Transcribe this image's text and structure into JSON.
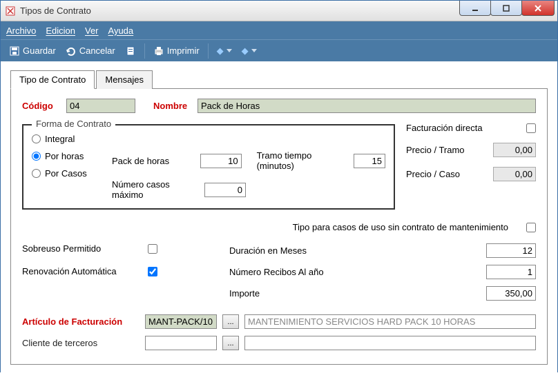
{
  "window": {
    "title": "Tipos de Contrato"
  },
  "menu": {
    "archivo": "Archivo",
    "edicion": "Edicion",
    "ver": "Ver",
    "ayuda": "Ayuda"
  },
  "toolbar": {
    "guardar": "Guardar",
    "cancelar": "Cancelar",
    "imprimir": "Imprimir"
  },
  "tabs": {
    "tipo": "Tipo de Contrato",
    "mensajes": "Mensajes"
  },
  "header": {
    "codigo_label": "Código",
    "codigo_value": "04",
    "nombre_label": "Nombre",
    "nombre_value": "Pack de Horas"
  },
  "forma": {
    "legend": "Forma de Contrato",
    "integral": "Integral",
    "por_horas": "Por horas",
    "por_casos": "Por Casos",
    "pack_horas_label": "Pack de horas",
    "pack_horas_value": "10",
    "tramo_label": "Tramo tiempo (minutos)",
    "tramo_value": "15",
    "num_casos_label": "Número casos máximo",
    "num_casos_value": "0"
  },
  "side": {
    "fact_directa": "Facturación directa",
    "precio_tramo_label": "Precio / Tramo",
    "precio_tramo_value": "0,00",
    "precio_caso_label": "Precio / Caso",
    "precio_caso_value": "0,00"
  },
  "tipo_sin_contrato": "Tipo para casos de uso sin contrato de mantenimiento",
  "left": {
    "sobreuso": "Sobreuso Permitido",
    "renovacion": "Renovación Automática"
  },
  "right": {
    "duracion_label": "Duración en Meses",
    "duracion_value": "12",
    "recibos_label": "Número Recibos Al año",
    "recibos_value": "1",
    "importe_label": "Importe",
    "importe_value": "350,00"
  },
  "articulo": {
    "label": "Artículo de Facturación",
    "code": "MANT-PACK/10",
    "desc": "MANTENIMIENTO SERVICIOS HARD PACK 10 HORAS"
  },
  "cliente": {
    "label": "Cliente de terceros",
    "code": "",
    "desc": ""
  },
  "icons": {
    "dots": "..."
  }
}
